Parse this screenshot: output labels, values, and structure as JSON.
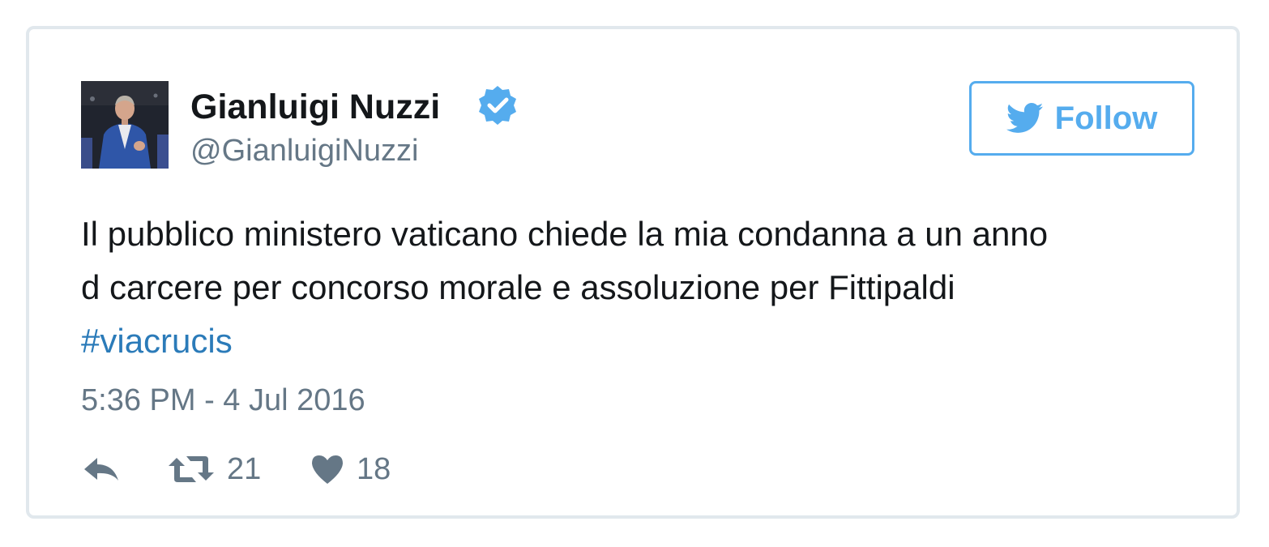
{
  "tweet": {
    "author": {
      "name": "Gianluigi Nuzzi",
      "handle": "@GianluigiNuzzi",
      "verified": true
    },
    "follow_label": "Follow",
    "text_lines": [
      "Il pubblico ministero vaticano chiede la mia condanna a un anno",
      "d carcere per concorso morale e assoluzione per Fittipaldi"
    ],
    "hashtag": "#viacrucis",
    "timestamp": "5:36 PM - 4 Jul 2016",
    "retweet_count": "21",
    "like_count": "18"
  },
  "colors": {
    "text": "#14171a",
    "secondary": "#657786",
    "link": "#2b7bb9",
    "accent": "#55acee",
    "border": "#e1e8ed"
  },
  "icons": {
    "verified": "verified-badge-icon",
    "follow": "twitter-bird-icon",
    "reply": "reply-icon",
    "retweet": "retweet-icon",
    "like": "heart-icon"
  }
}
